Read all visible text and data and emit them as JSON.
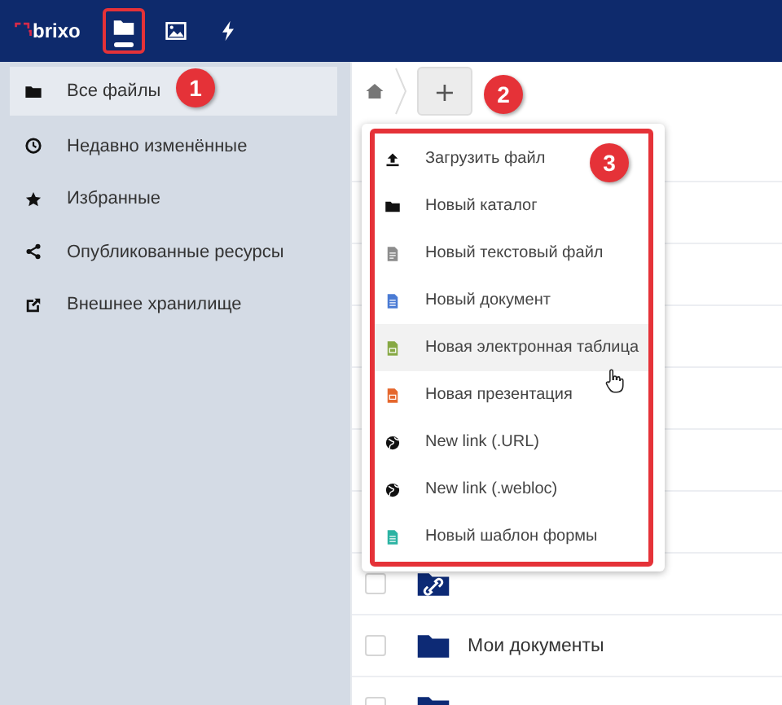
{
  "top_bar": {
    "logo": "brixo",
    "apps": [
      {
        "kind": "folder",
        "selected": true,
        "highlighted": true
      },
      {
        "kind": "image",
        "selected": false,
        "highlighted": false
      },
      {
        "kind": "bolt",
        "selected": false,
        "highlighted": false
      }
    ]
  },
  "sidebar": {
    "items": [
      {
        "kind": "folder",
        "label": "Все файлы",
        "selected": true
      },
      {
        "kind": "clock",
        "label": "Недавно изменённые",
        "selected": false
      },
      {
        "kind": "star",
        "label": "Избранные",
        "selected": false
      },
      {
        "kind": "share",
        "label": "Опубликованные ресурсы",
        "selected": false
      },
      {
        "kind": "external",
        "label": "Внешнее хранилище",
        "selected": false
      }
    ]
  },
  "breadcrumb": {
    "new_button": "+"
  },
  "new_menu": {
    "highlighted": true,
    "items": [
      {
        "kind": "upload",
        "label": "Загрузить файл",
        "hovered": false
      },
      {
        "kind": "folder",
        "label": "Новый каталог",
        "hovered": false
      },
      {
        "kind": "text",
        "label": "Новый текстовый файл",
        "hovered": false
      },
      {
        "kind": "doc",
        "label": "Новый документ",
        "hovered": false
      },
      {
        "kind": "sheet",
        "label": "Новая электронная таблица",
        "hovered": true
      },
      {
        "kind": "slides",
        "label": "Новая презентация",
        "hovered": false
      },
      {
        "kind": "globe",
        "label": "New link (.URL)",
        "hovered": false
      },
      {
        "kind": "globe",
        "label": "New link (.webloc)",
        "hovered": false
      },
      {
        "kind": "form",
        "label": "Новый шаблон формы",
        "hovered": false
      }
    ]
  },
  "files": [
    {
      "kind": "link",
      "checked": false
    },
    {
      "kind": "folder",
      "name": "Мои документы",
      "checked": false
    },
    {
      "kind": "folder",
      "checked": false
    }
  ],
  "callouts": [
    "1",
    "2",
    "3"
  ]
}
